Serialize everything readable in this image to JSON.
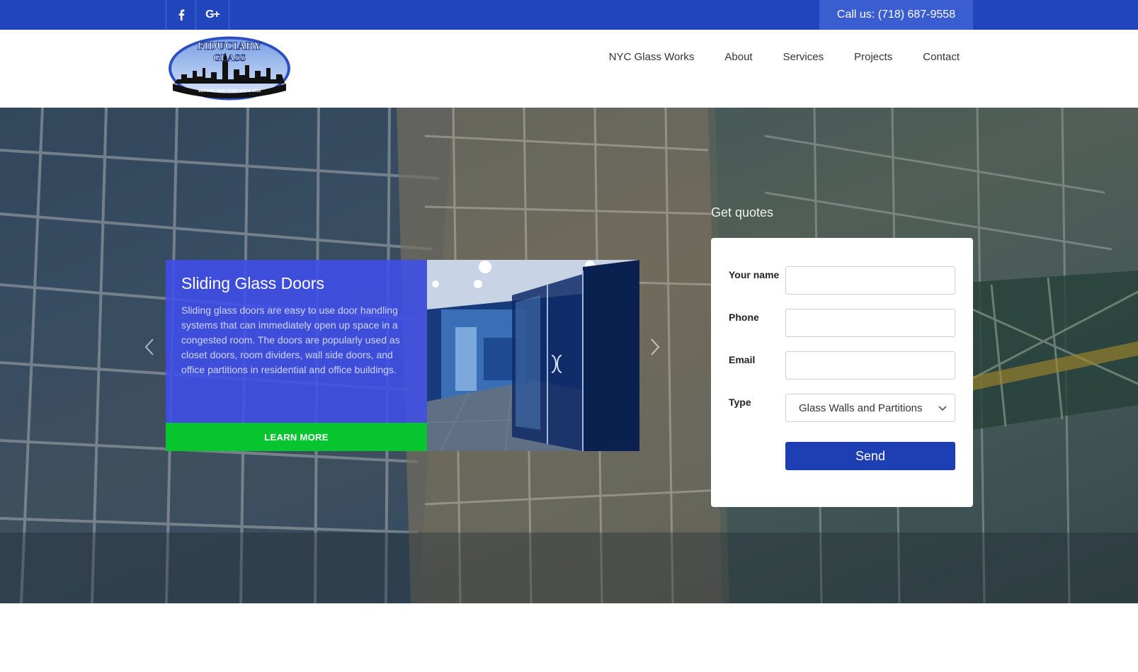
{
  "topbar": {
    "social": [
      {
        "name": "facebook-icon",
        "label": "f"
      },
      {
        "name": "google-plus-icon",
        "label": "G+"
      }
    ],
    "call_label": "Call us: (718) 687-9558"
  },
  "header": {
    "logo": {
      "line1": "FIDUCIARY",
      "line2": "GLASS",
      "tagline": "SERVING NEW YORK SINCE 2010"
    },
    "nav": [
      "NYC Glass Works",
      "About",
      "Services",
      "Projects",
      "Contact"
    ]
  },
  "slider": {
    "title": "Sliding Glass Doors",
    "description": "Sliding glass doors are easy to use door handling systems that can immediately open up space in a congested room. The doors are popularly used as closet doors, room dividers, wall side doors, and office partitions in residential and office buildings.",
    "button_label": "LEARN MORE"
  },
  "quote_form": {
    "title": "Get quotes",
    "fields": [
      {
        "label": "Your name",
        "value": ""
      },
      {
        "label": "Phone",
        "value": ""
      },
      {
        "label": "Email",
        "value": ""
      }
    ],
    "type_label": "Type",
    "type_selected": "Glass Walls and Partitions",
    "send_label": "Send"
  },
  "colors": {
    "brand_blue": "#2145bd",
    "call_blue": "#3a5dd0",
    "slide_blue": "#404eeb",
    "learn_green": "#06c52e",
    "send_blue": "#1e3fb4"
  }
}
